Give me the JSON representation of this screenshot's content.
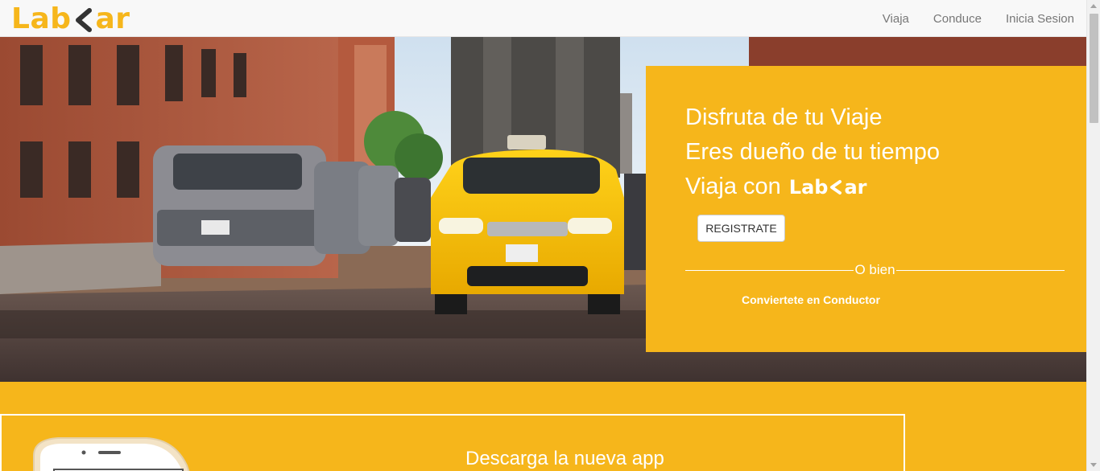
{
  "brand": {
    "name_left": "Lab",
    "name_right": "ar",
    "color": "#f6b61b",
    "icon": "chevron-left-icon"
  },
  "nav": {
    "items": [
      {
        "label": "Viaja"
      },
      {
        "label": "Conduce"
      },
      {
        "label": "Inicia Sesion"
      }
    ]
  },
  "hero": {
    "line1": "Disfruta de tu Viaje",
    "line2": "Eres dueño de tu tiempo",
    "line3_prefix": "Viaja con",
    "register_button": "REGISTRATE",
    "divider_text": "O bien",
    "driver_link": "Conviertete en Conductor"
  },
  "app_section": {
    "title": "Descarga la nueva app"
  },
  "colors": {
    "accent": "#f6b61b",
    "navbar_bg": "#f8f8f8",
    "nav_text": "#777777"
  }
}
